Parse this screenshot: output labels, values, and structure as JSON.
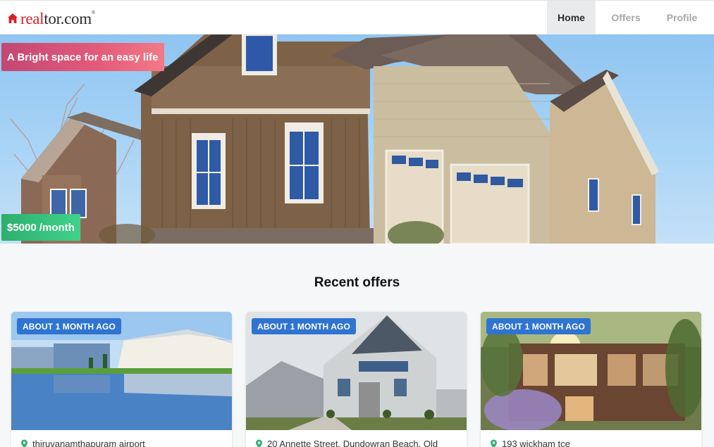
{
  "brand": {
    "logo_real": "real",
    "logo_tor": "tor.com",
    "logo_mark": "®",
    "accent": "#d92228"
  },
  "nav": {
    "items": [
      {
        "label": "Home",
        "active": true
      },
      {
        "label": "Offers",
        "active": false
      },
      {
        "label": "Profile",
        "active": false
      }
    ]
  },
  "hero": {
    "tagline": "A Bright space for an easy life",
    "price": "$5000 /month"
  },
  "offers": {
    "title": "Recent offers",
    "cards": [
      {
        "badge": "ABOUT 1 MONTH AGO",
        "address": "thiruvanamthapuram airport",
        "icon": "location-pin-icon"
      },
      {
        "badge": "ABOUT 1 MONTH AGO",
        "address": "20 Annette Street, Dundowran Beach, Qld",
        "icon": "location-pin-icon"
      },
      {
        "badge": "ABOUT 1 MONTH AGO",
        "address": "193 wickham tce",
        "icon": "location-pin-icon"
      }
    ]
  },
  "colors": {
    "badge": "#2f74d0",
    "tagline_gradient": [
      "#c24872",
      "#f27a86"
    ],
    "price_gradient": [
      "#2fae6e",
      "#3fd28a"
    ],
    "pin": "#2fae6e"
  }
}
